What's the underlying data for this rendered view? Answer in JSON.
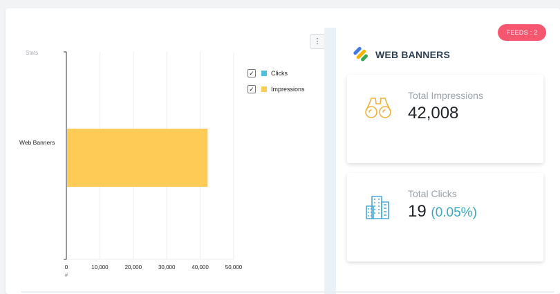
{
  "stats_label": "Stats",
  "menu_icon": "kebab-vertical-icon",
  "legend": [
    {
      "label": "Clicks",
      "checked": true,
      "color": "#4fc0e0"
    },
    {
      "label": "Impressions",
      "checked": true,
      "color": "#ffcb57"
    }
  ],
  "chart_data": {
    "type": "bar",
    "orientation": "horizontal",
    "categories": [
      "Web Banners"
    ],
    "series": [
      {
        "name": "Clicks",
        "values": [
          19
        ]
      },
      {
        "name": "Impressions",
        "values": [
          42008
        ]
      }
    ],
    "xlim": [
      0,
      50000
    ],
    "xticks": [
      "0",
      "10,000",
      "20,000",
      "30,000",
      "40,000",
      "50,000"
    ],
    "xlabel": "#",
    "grid": true,
    "legend_placement": "top-right"
  },
  "feeds_badge": "FEEDS : 2",
  "panel_title": "WEB BANNERS",
  "impressions": {
    "label": "Total Impressions",
    "value": "42,008",
    "icon": "binoculars-icon"
  },
  "clicks": {
    "label": "Total Clicks",
    "value": "19",
    "percent": "(0.05%)",
    "icon": "buildings-icon"
  }
}
